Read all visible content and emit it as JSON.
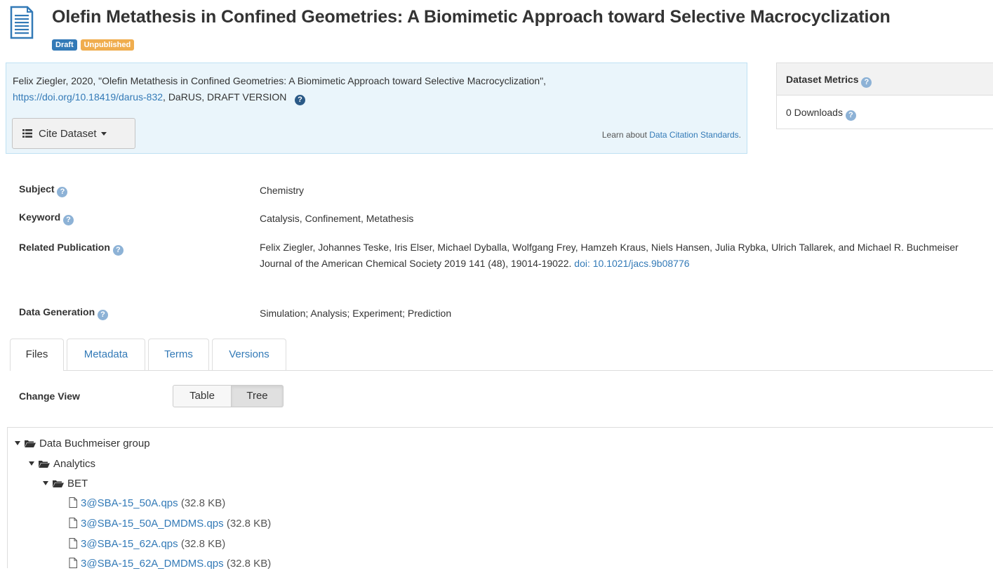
{
  "header": {
    "title": "Olefin Metathesis in Confined Geometries: A Biomimetic Approach toward Selective Macrocyclization",
    "badges": {
      "draft": "Draft",
      "unpublished": "Unpublished"
    },
    "icon": "document-icon"
  },
  "citation": {
    "text_before": "Felix Ziegler, 2020, \"Olefin Metathesis in Confined Geometries: A Biomimetic Approach toward Selective Macrocyclization\",",
    "doi_link": "https://doi.org/10.18419/darus-832",
    "text_after": ", DaRUS, DRAFT VERSION",
    "cite_button": "Cite Dataset",
    "learn_prefix": "Learn about",
    "learn_link": "Data Citation Standards",
    "learn_suffix": "."
  },
  "metrics": {
    "title": "Dataset Metrics",
    "downloads": "0 Downloads"
  },
  "metadata": {
    "subject": {
      "label": "Subject",
      "value": "Chemistry"
    },
    "keyword": {
      "label": "Keyword",
      "value": "Catalysis, Confinement, Metathesis"
    },
    "related_publication": {
      "label": "Related Publication",
      "value": "Felix Ziegler, Johannes Teske, Iris Elser, Michael Dyballa, Wolfgang Frey, Hamzeh Kraus, Niels Hansen, Julia Rybka, Ulrich Tallarek, and Michael R. Buchmeiser Journal of the American Chemical Society 2019 141 (48), 19014-19022.",
      "link": "doi: 10.1021/jacs.9b08776"
    },
    "data_generation": {
      "label": "Data Generation",
      "value": "Simulation; Analysis; Experiment; Prediction"
    }
  },
  "tabs": [
    "Files",
    "Metadata",
    "Terms",
    "Versions"
  ],
  "change_view": {
    "label": "Change View",
    "table": "Table",
    "tree": "Tree"
  },
  "tree": {
    "root": "Data Buchmeiser group",
    "analytics": "Analytics",
    "bet": "BET",
    "files": [
      {
        "name": "3@SBA-15_50A.qps",
        "size": "(32.8 KB)"
      },
      {
        "name": "3@SBA-15_50A_DMDMS.qps",
        "size": "(32.8 KB)"
      },
      {
        "name": "3@SBA-15_62A.qps",
        "size": "(32.8 KB)"
      },
      {
        "name": "3@SBA-15_62A_DMDMS.qps",
        "size": "(32.8 KB)"
      }
    ]
  }
}
